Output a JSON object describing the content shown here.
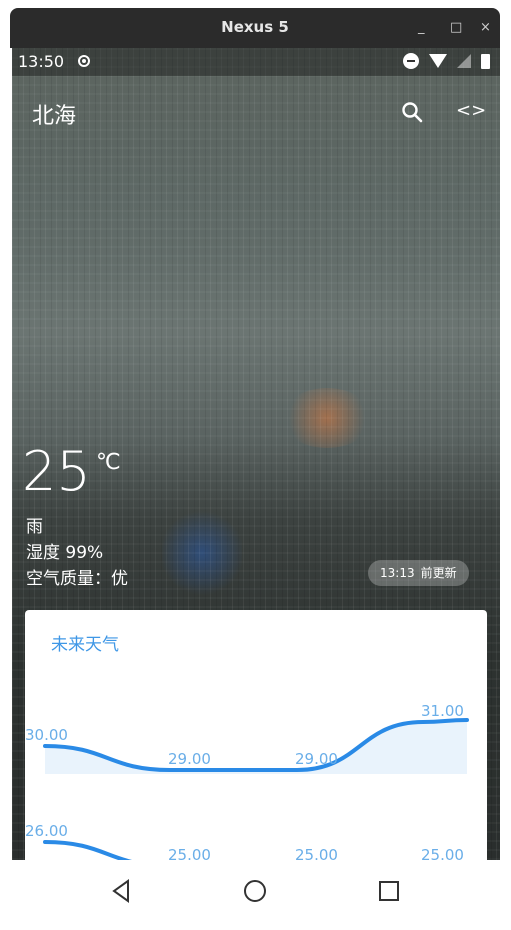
{
  "emulator": {
    "title": "Nexus 5",
    "min": "_",
    "max": "□",
    "close": "×"
  },
  "status_bar": {
    "time": "13:50"
  },
  "app_bar": {
    "city": "北海",
    "code_icon_text": "<>"
  },
  "current": {
    "temperature": "25",
    "unit": "℃",
    "condition": "雨",
    "humidity": "湿度 99%",
    "air_quality": "空气质量：优"
  },
  "update_pill": {
    "time": "13:13",
    "suffix": "前更新"
  },
  "forecast": {
    "title": "未来天气"
  },
  "chart_data": {
    "type": "line",
    "series": [
      {
        "values": [
          30.0,
          29.0,
          29.0,
          31.0
        ],
        "labels": [
          "30.00",
          "29.00",
          "29.00",
          "31.00"
        ]
      },
      {
        "values": [
          26.0,
          25.0,
          25.0,
          25.0
        ],
        "labels": [
          "26.00",
          "25.00",
          "25.00",
          "25.00"
        ]
      }
    ],
    "line_color": "#2a8ae6",
    "label_color": "#6aaee8"
  }
}
